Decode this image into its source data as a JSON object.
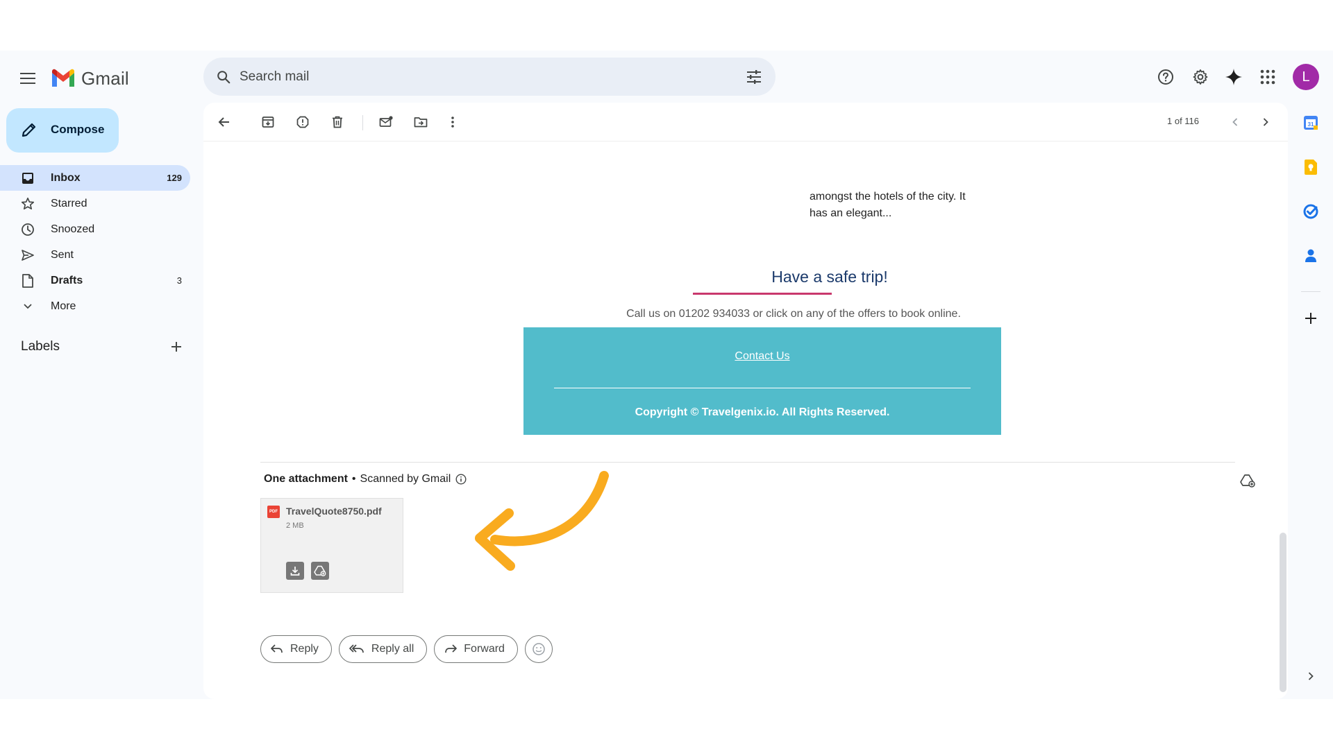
{
  "app": {
    "name": "Gmail"
  },
  "search": {
    "placeholder": "Search mail"
  },
  "header": {
    "avatar_letter": "L"
  },
  "compose": {
    "label": "Compose"
  },
  "nav": {
    "items": [
      {
        "label": "Inbox",
        "count": "129"
      },
      {
        "label": "Starred",
        "count": ""
      },
      {
        "label": "Snoozed",
        "count": ""
      },
      {
        "label": "Sent",
        "count": ""
      },
      {
        "label": "Drafts",
        "count": "3"
      },
      {
        "label": "More",
        "count": ""
      }
    ],
    "labels_header": "Labels"
  },
  "toolbar": {
    "pager": "1 of 116"
  },
  "email": {
    "hotel_text": "amongst the hotels of the city. It has an elegant...",
    "safe_trip": "Have a safe trip!",
    "call_us": "Call us on 01202 934033 or click on any of the offers to book online.",
    "contact_link": "Contact Us",
    "copyright": "Copyright © Travelgenix.io. All Rights Reserved."
  },
  "attachments": {
    "header": "One attachment",
    "separator": "•",
    "scanned": "Scanned by Gmail",
    "file": {
      "name": "TravelQuote8750.pdf",
      "size": "2 MB",
      "badge": "PDF"
    }
  },
  "actions": {
    "reply": "Reply",
    "reply_all": "Reply all",
    "forward": "Forward"
  },
  "colors": {
    "accent": "#c2e7ff",
    "footer": "#52bccb",
    "arrow": "#f9ab1f",
    "avatar": "#a12aa7"
  }
}
